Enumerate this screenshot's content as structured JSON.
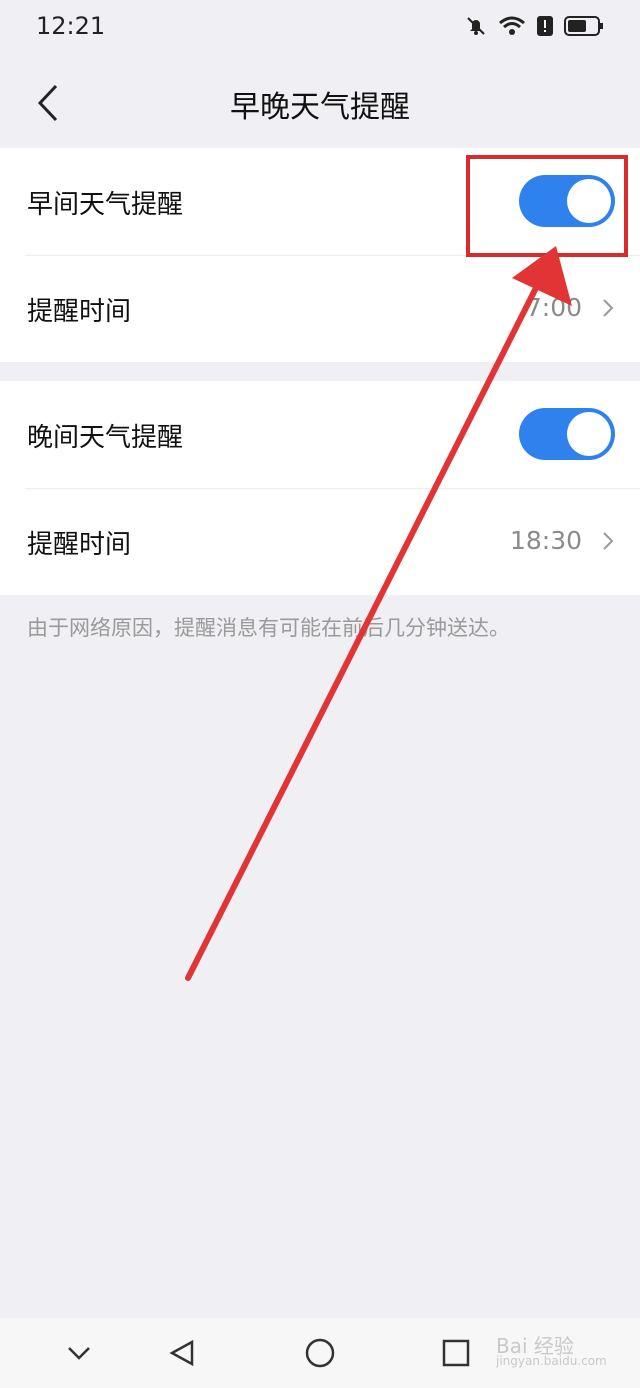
{
  "status_bar": {
    "time": "12:21",
    "icons": [
      "bell-off-icon",
      "wifi-icon",
      "alert-icon",
      "battery-icon"
    ]
  },
  "header": {
    "title": "早晚天气提醒"
  },
  "morning": {
    "label": "早间天气提醒",
    "enabled": true,
    "time_label": "提醒时间",
    "time_value": "7:00"
  },
  "evening": {
    "label": "晚间天气提醒",
    "enabled": true,
    "time_label": "提醒时间",
    "time_value": "18:30"
  },
  "note": "由于网络原因，提醒消息有可能在前后几分钟送达。",
  "watermark": {
    "main": "Bai 经验",
    "sub": "jingyan.baidu.com"
  },
  "colors": {
    "toggle_on": "#2f82ee",
    "annotation": "#d92b2b",
    "background": "#efeff4"
  }
}
